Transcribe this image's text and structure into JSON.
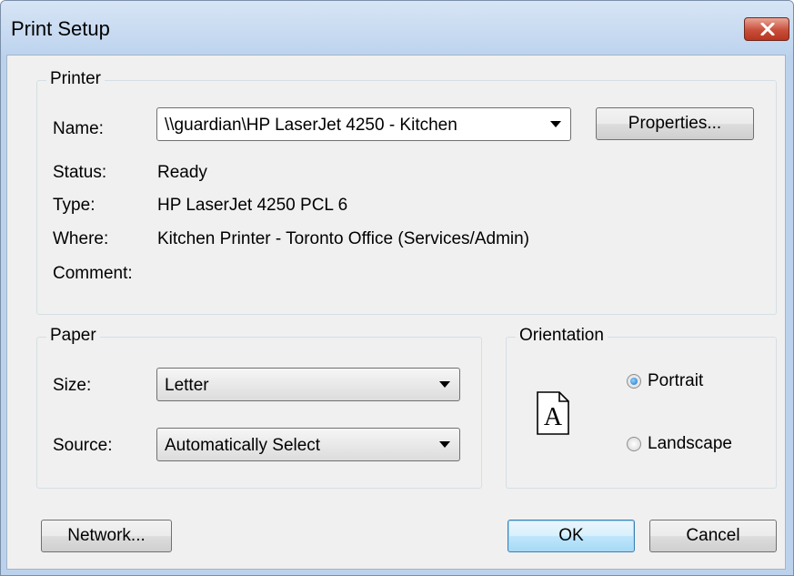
{
  "window": {
    "title": "Print Setup"
  },
  "printer": {
    "group_label": "Printer",
    "name_label": "Name:",
    "name_value": "\\\\guardian\\HP LaserJet 4250 - Kitchen",
    "properties_label": "Properties...",
    "status_label": "Status:",
    "status_value": "Ready",
    "type_label": "Type:",
    "type_value": "HP LaserJet 4250 PCL 6",
    "where_label": "Where:",
    "where_value": "Kitchen Printer - Toronto Office (Services/Admin)",
    "comment_label": "Comment:",
    "comment_value": ""
  },
  "paper": {
    "group_label": "Paper",
    "size_label": "Size:",
    "size_value": "Letter",
    "source_label": "Source:",
    "source_value": "Automatically Select"
  },
  "orientation": {
    "group_label": "Orientation",
    "portrait_label": "Portrait",
    "landscape_label": "Landscape",
    "selected": "Portrait",
    "icon_letter": "A"
  },
  "buttons": {
    "network_label": "Network...",
    "ok_label": "OK",
    "cancel_label": "Cancel"
  },
  "icons": {
    "close": "close-icon",
    "dropdown": "chevron-down-icon",
    "orientation_preview": "page-portrait-icon"
  },
  "colors": {
    "title_bar": "#bdd3ee",
    "close_button": "#c84f3a",
    "dialog_bg": "#f0f0f0",
    "default_button": "#bee6fd"
  }
}
